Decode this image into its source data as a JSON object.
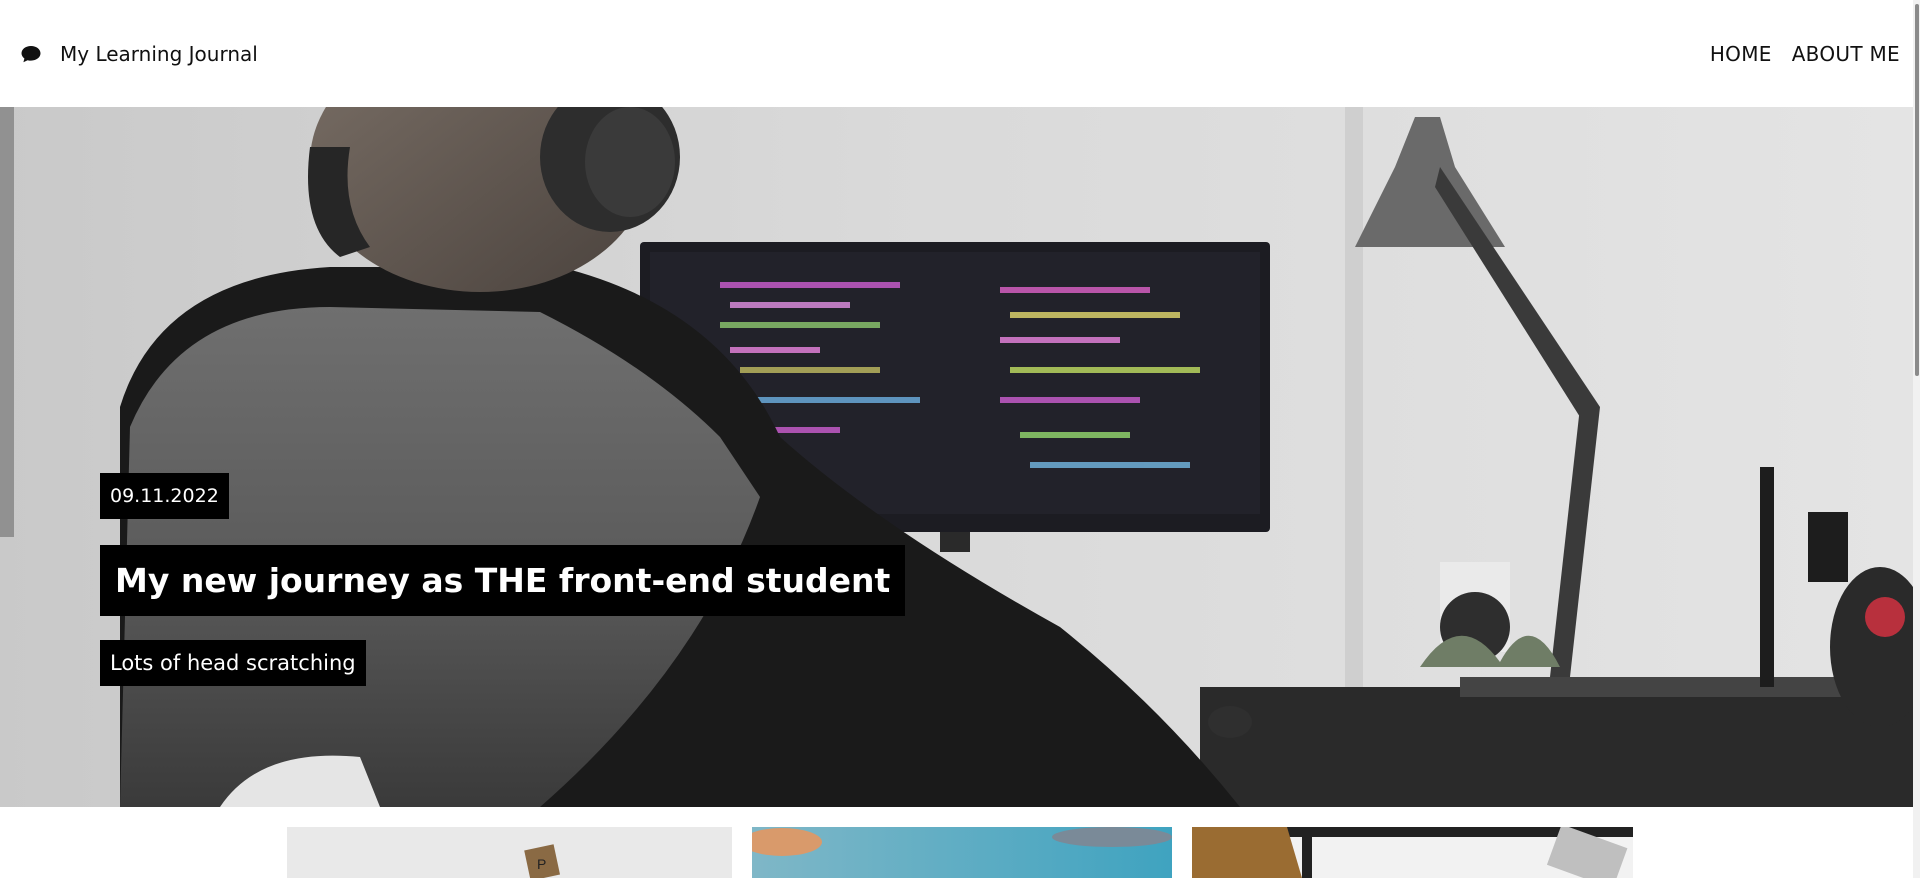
{
  "header": {
    "brand_icon": "chat-bubble-icon",
    "brand_title": "My Learning Journal",
    "nav": [
      {
        "label": "HOME"
      },
      {
        "label": "ABOUT ME"
      }
    ]
  },
  "hero": {
    "date": "09.11.2022",
    "title": "My new journey as THE front-end student",
    "subtitle": "Lots of head scratching",
    "image": "person-with-headphones-coding-at-desk"
  },
  "cards": [
    {
      "image": "scrabble-tiles-thumbnail"
    },
    {
      "image": "sky-clouds-thumbnail"
    },
    {
      "image": "person-at-laptop-window-thumbnail"
    }
  ],
  "colors": {
    "tag_background": "#000000",
    "tag_text": "#ffffff",
    "header_background": "#ffffff"
  }
}
